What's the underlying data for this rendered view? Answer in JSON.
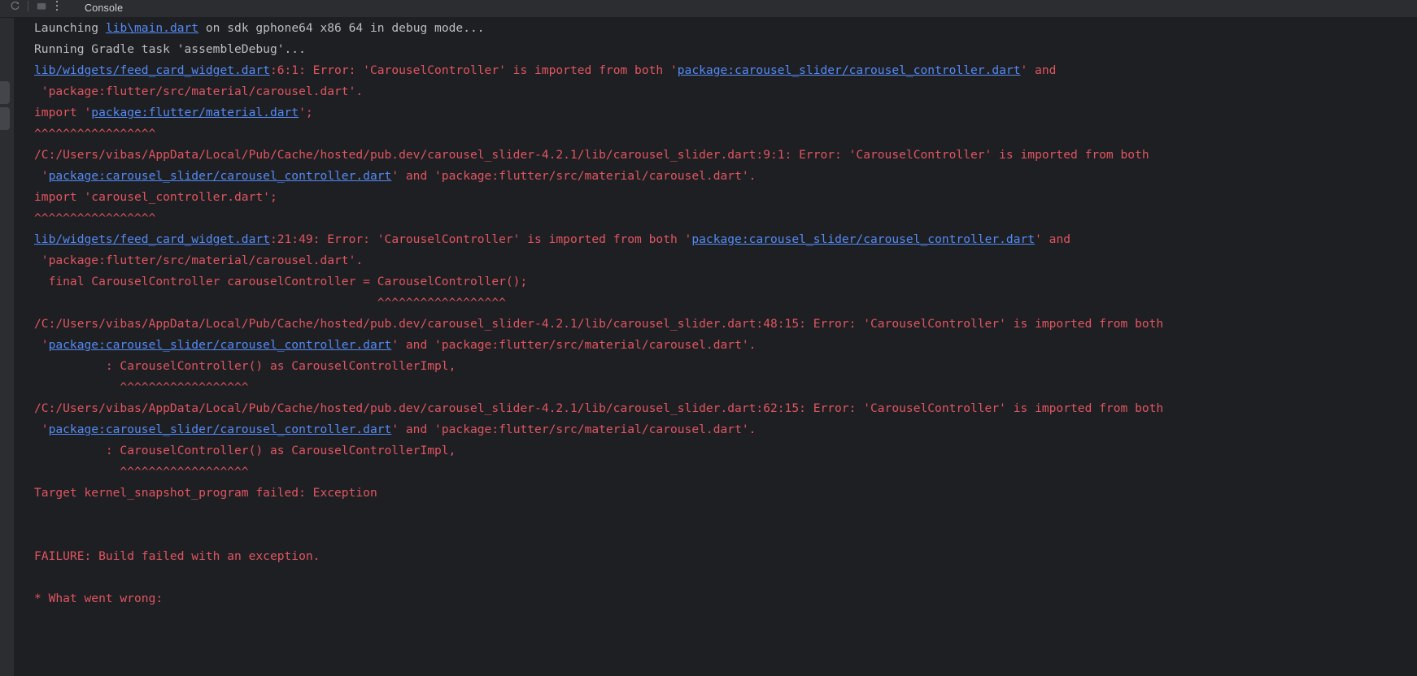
{
  "window": {
    "background_color": "#1e1f22",
    "toolbar_color": "#2b2d30"
  },
  "toolbar": {
    "tab_label": "Console",
    "icons": [
      {
        "name": "rerun-icon",
        "glyph": "↺"
      },
      {
        "name": "layout-icon",
        "glyph": "⬛"
      },
      {
        "name": "more-options-icon",
        "glyph": "⋮"
      }
    ]
  },
  "colors": {
    "info_text": "#bcbec4",
    "error_text": "#e05561",
    "link_text": "#548af7"
  },
  "console": {
    "lines": [
      {
        "id": "line-1",
        "segments": [
          {
            "text": "Launching ",
            "style": "info"
          },
          {
            "text": "lib\\main.dart",
            "style": "link"
          },
          {
            "text": " on sdk gphone64 x86 64 in debug mode...",
            "style": "info"
          }
        ]
      },
      {
        "id": "line-2",
        "segments": [
          {
            "text": "Running Gradle task 'assembleDebug'...",
            "style": "info"
          }
        ]
      },
      {
        "id": "line-3",
        "segments": [
          {
            "text": "lib/widgets/feed_card_widget.dart",
            "style": "link"
          },
          {
            "text": ":6:1: Error: 'CarouselController' is imported from both '",
            "style": "error"
          },
          {
            "text": "package:carousel_slider/carousel_controller.dart",
            "style": "link"
          },
          {
            "text": "' and",
            "style": "error"
          }
        ]
      },
      {
        "id": "line-4",
        "segments": [
          {
            "text": " 'package:flutter/src/material/carousel.dart'.",
            "style": "error"
          }
        ]
      },
      {
        "id": "line-5",
        "segments": [
          {
            "text": "import '",
            "style": "error"
          },
          {
            "text": "package:flutter/material.dart",
            "style": "link"
          },
          {
            "text": "';",
            "style": "error"
          }
        ]
      },
      {
        "id": "line-6",
        "segments": [
          {
            "text": "^^^^^^^^^^^^^^^^^",
            "style": "error"
          }
        ]
      },
      {
        "id": "line-7",
        "segments": [
          {
            "text": "/C:/Users/vibas/AppData/Local/Pub/Cache/hosted/pub.dev/carousel_slider-4.2.1/lib/carousel_slider.dart:9:1: Error: 'CarouselController' is imported from both",
            "style": "error"
          }
        ]
      },
      {
        "id": "line-8",
        "segments": [
          {
            "text": " '",
            "style": "error"
          },
          {
            "text": "package:carousel_slider/carousel_controller.dart",
            "style": "link"
          },
          {
            "text": "' and 'package:flutter/src/material/carousel.dart'.",
            "style": "error"
          }
        ]
      },
      {
        "id": "line-9",
        "segments": [
          {
            "text": "import 'carousel_controller.dart';",
            "style": "error"
          }
        ]
      },
      {
        "id": "line-10",
        "segments": [
          {
            "text": "^^^^^^^^^^^^^^^^^",
            "style": "error"
          }
        ]
      },
      {
        "id": "line-11",
        "segments": [
          {
            "text": "lib/widgets/feed_card_widget.dart",
            "style": "link"
          },
          {
            "text": ":21:49: Error: 'CarouselController' is imported from both '",
            "style": "error"
          },
          {
            "text": "package:carousel_slider/carousel_controller.dart",
            "style": "link"
          },
          {
            "text": "' and",
            "style": "error"
          }
        ]
      },
      {
        "id": "line-12",
        "segments": [
          {
            "text": " 'package:flutter/src/material/carousel.dart'.",
            "style": "error"
          }
        ]
      },
      {
        "id": "line-13",
        "segments": [
          {
            "text": "  final CarouselController carouselController = CarouselController();",
            "style": "error"
          }
        ]
      },
      {
        "id": "line-14",
        "segments": [
          {
            "text": "                                                ^^^^^^^^^^^^^^^^^^",
            "style": "error"
          }
        ]
      },
      {
        "id": "line-15",
        "segments": [
          {
            "text": "/C:/Users/vibas/AppData/Local/Pub/Cache/hosted/pub.dev/carousel_slider-4.2.1/lib/carousel_slider.dart:48:15: Error: 'CarouselController' is imported from both",
            "style": "error"
          }
        ]
      },
      {
        "id": "line-16",
        "segments": [
          {
            "text": " '",
            "style": "error"
          },
          {
            "text": "package:carousel_slider/carousel_controller.dart",
            "style": "link"
          },
          {
            "text": "' and 'package:flutter/src/material/carousel.dart'.",
            "style": "error"
          }
        ]
      },
      {
        "id": "line-17",
        "segments": [
          {
            "text": "          : CarouselController() as CarouselControllerImpl,",
            "style": "error"
          }
        ]
      },
      {
        "id": "line-18",
        "segments": [
          {
            "text": "            ^^^^^^^^^^^^^^^^^^",
            "style": "error"
          }
        ]
      },
      {
        "id": "line-19",
        "segments": [
          {
            "text": "/C:/Users/vibas/AppData/Local/Pub/Cache/hosted/pub.dev/carousel_slider-4.2.1/lib/carousel_slider.dart:62:15: Error: 'CarouselController' is imported from both",
            "style": "error"
          }
        ]
      },
      {
        "id": "line-20",
        "segments": [
          {
            "text": " '",
            "style": "error"
          },
          {
            "text": "package:carousel_slider/carousel_controller.dart",
            "style": "link"
          },
          {
            "text": "' and 'package:flutter/src/material/carousel.dart'.",
            "style": "error"
          }
        ]
      },
      {
        "id": "line-21",
        "segments": [
          {
            "text": "          : CarouselController() as CarouselControllerImpl,",
            "style": "error"
          }
        ]
      },
      {
        "id": "line-22",
        "segments": [
          {
            "text": "            ^^^^^^^^^^^^^^^^^^",
            "style": "error"
          }
        ]
      },
      {
        "id": "line-23",
        "segments": [
          {
            "text": "Target kernel_snapshot_program failed: Exception",
            "style": "error"
          }
        ]
      },
      {
        "id": "line-24",
        "segments": []
      },
      {
        "id": "line-25",
        "segments": []
      },
      {
        "id": "line-26",
        "segments": [
          {
            "text": "FAILURE: Build failed with an exception.",
            "style": "error"
          }
        ]
      },
      {
        "id": "line-27",
        "segments": []
      },
      {
        "id": "line-28",
        "segments": [
          {
            "text": "* What went wrong:",
            "style": "error"
          }
        ]
      }
    ]
  }
}
